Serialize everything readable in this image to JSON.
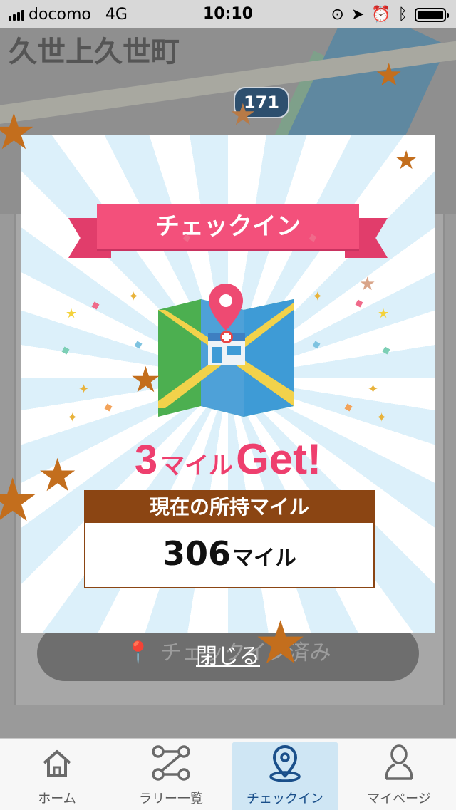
{
  "status_bar": {
    "carrier": "docomo",
    "network": "4G",
    "time": "10:10"
  },
  "map": {
    "place_name": "久世上久世町",
    "route_number": "171"
  },
  "background_button": {
    "label": "チェックイン済み"
  },
  "modal": {
    "ribbon_title": "チェックイン",
    "earned_number": "3",
    "earned_unit": "マイル",
    "earned_suffix": "Get!",
    "current_miles_heading": "現在の所持マイル",
    "current_miles_value": "306",
    "current_miles_unit": "マイル",
    "close_label": "閉じる"
  },
  "tab_bar": {
    "tabs": [
      {
        "label": "ホーム",
        "icon": "home-icon"
      },
      {
        "label": "ラリー一覧",
        "icon": "route-icon"
      },
      {
        "label": "チェックイン",
        "icon": "map-pin-icon",
        "active": true
      },
      {
        "label": "マイページ",
        "icon": "person-icon"
      }
    ]
  },
  "colors": {
    "ribbon": "#f3507b",
    "get_text": "#ee3f6e",
    "miles_header": "#8b4513",
    "star": "#c36e1d",
    "active_tab": "#cfe6f4"
  }
}
